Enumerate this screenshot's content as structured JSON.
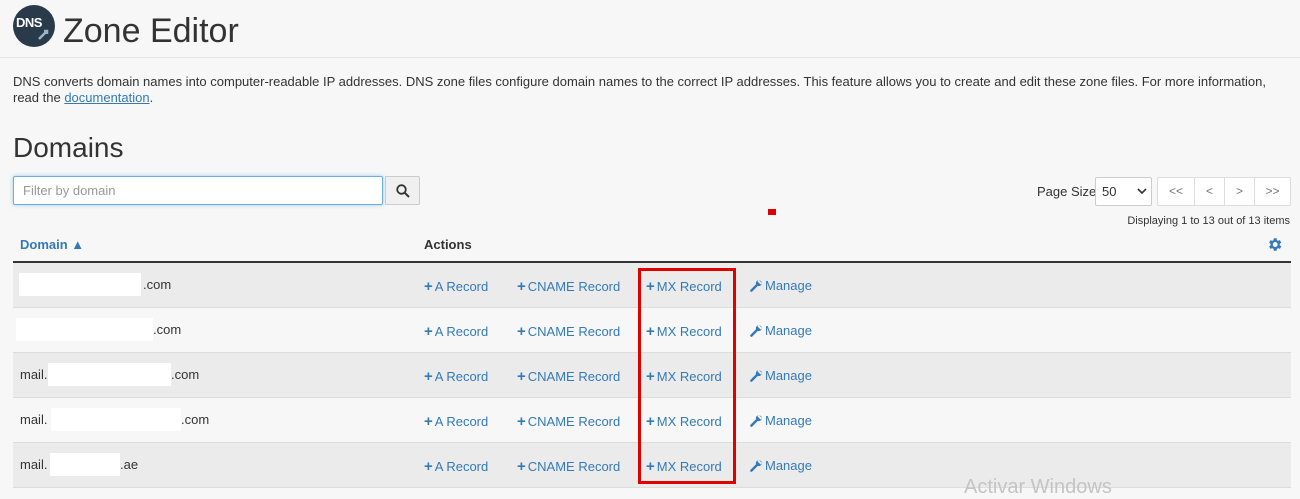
{
  "header": {
    "logo_text": "DNS",
    "title": "Zone Editor"
  },
  "description": {
    "text": "DNS converts domain names into computer-readable IP addresses. DNS zone files configure domain names to the correct IP addresses. This feature allows you to create and edit these zone files. For more information, read the ",
    "link_text": "documentation",
    "end": "."
  },
  "domains": {
    "heading": "Domains",
    "filter_placeholder": "Filter by domain",
    "page_size_label": "Page Size",
    "page_size_value": "50",
    "pager": {
      "first": "<<",
      "prev": "<",
      "next": ">",
      "last": ">>"
    },
    "displaying": "Displaying 1 to 13 out of 13 items",
    "columns": {
      "domain": "Domain ▲",
      "actions": "Actions"
    },
    "action_labels": {
      "a": "A Record",
      "cname": "CNAME Record",
      "mx": "MX Record",
      "manage": "Manage"
    },
    "rows": [
      {
        "prefix": "",
        "suffix": ".com"
      },
      {
        "prefix": "",
        "suffix": ".com"
      },
      {
        "prefix": "mail.",
        "suffix": ".com"
      },
      {
        "prefix": "mail.",
        "suffix": ".com"
      },
      {
        "prefix": "mail.",
        "suffix": ".ae"
      }
    ]
  },
  "watermark": "Activar Windows",
  "colors": {
    "link": "#337ab7",
    "highlight": "#e00000",
    "logo_bg": "#293a4a"
  },
  "icons": [
    "dns-logo-icon",
    "search-icon",
    "chevron-down-icon",
    "gear-icon",
    "plus-icon",
    "wrench-icon"
  ]
}
